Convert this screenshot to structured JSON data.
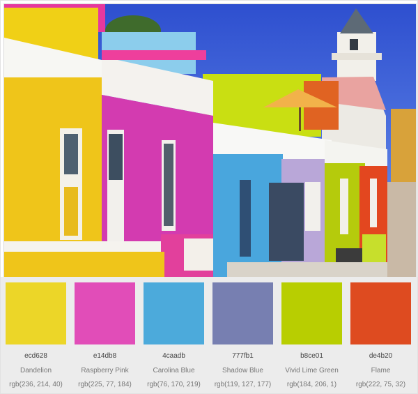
{
  "photo": {
    "subject": "colorful houses"
  },
  "palette": [
    {
      "hex": "ecd628",
      "name": "Dandelion",
      "rgb": "rgb(236, 214, 40)",
      "color": "#ecd628"
    },
    {
      "hex": "e14db8",
      "name": "Raspberry Pink",
      "rgb": "rgb(225, 77, 184)",
      "color": "#e14db8"
    },
    {
      "hex": "4caadb",
      "name": "Carolina Blue",
      "rgb": "rgb(76, 170, 219)",
      "color": "#4caadb"
    },
    {
      "hex": "777fb1",
      "name": "Shadow Blue",
      "rgb": "rgb(119, 127, 177)",
      "color": "#777fb1"
    },
    {
      "hex": "b8ce01",
      "name": "Vivid Lime Green",
      "rgb": "rgb(184, 206, 1)",
      "color": "#b8ce01"
    },
    {
      "hex": "de4b20",
      "name": "Flame",
      "rgb": "rgb(222, 75, 32)",
      "color": "#de4b20"
    }
  ]
}
